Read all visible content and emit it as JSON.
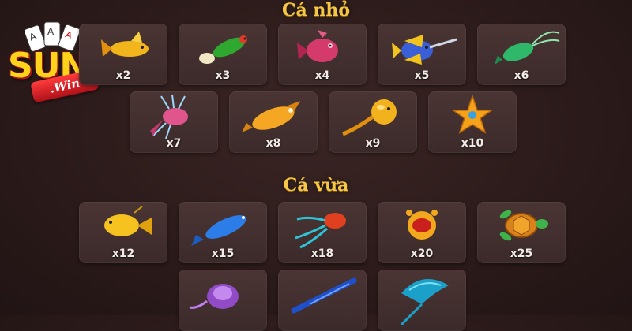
{
  "logo": {
    "brand": "SUN",
    "sub": ".Win"
  },
  "sections": [
    {
      "title": "Cá nhỏ",
      "items": [
        {
          "mult": "x2",
          "icon": "yellow-fish-icon"
        },
        {
          "mult": "x3",
          "icon": "green-fish-icon"
        },
        {
          "mult": "x4",
          "icon": "pink-fish-icon"
        },
        {
          "mult": "x5",
          "icon": "swordfish-icon"
        },
        {
          "mult": "x6",
          "icon": "green-shrimp-icon"
        },
        {
          "mult": "x7",
          "icon": "lionfish-icon"
        },
        {
          "mult": "x8",
          "icon": "submarine-fish-icon"
        },
        {
          "mult": "x9",
          "icon": "pufferfish-icon"
        },
        {
          "mult": "x10",
          "icon": "starfish-icon"
        }
      ]
    },
    {
      "title": "Cá vừa",
      "items": [
        {
          "mult": "x12",
          "icon": "yellow-blowfish-icon"
        },
        {
          "mult": "x15",
          "icon": "blue-fish-icon"
        },
        {
          "mult": "x18",
          "icon": "red-jellyfish-icon"
        },
        {
          "mult": "x20",
          "icon": "crab-icon"
        },
        {
          "mult": "x25",
          "icon": "turtle-icon"
        },
        {
          "mult": "",
          "icon": "purple-jellyfish-icon"
        },
        {
          "mult": "",
          "icon": "needlefish-icon"
        },
        {
          "mult": "",
          "icon": "manta-ray-icon"
        }
      ]
    }
  ],
  "colors": {
    "title": "#f6c744",
    "tile_bg": "#3f2c2b",
    "background": "#2b1a1a"
  }
}
